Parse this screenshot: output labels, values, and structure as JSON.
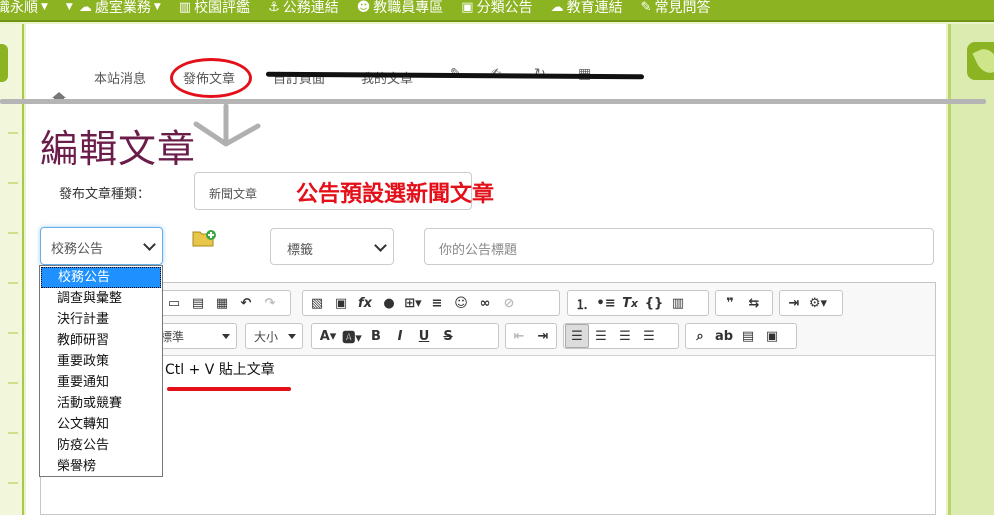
{
  "topnav": {
    "items": [
      {
        "icon": "dropdown-menu",
        "label": "識永順"
      },
      {
        "icon": "dropdown-menu",
        "label": "處室業務"
      },
      {
        "icon": "chart-icon",
        "label": "校園評鑑"
      },
      {
        "icon": "anchor-icon",
        "label": "公務連結"
      },
      {
        "icon": "smile-icon",
        "label": "教職員專區"
      },
      {
        "icon": "inbox-icon",
        "label": "分類公告"
      },
      {
        "icon": "cloud-icon",
        "label": "教育連結"
      },
      {
        "icon": "pen-icon",
        "label": "常見問答"
      }
    ]
  },
  "subnav": {
    "items": [
      "本站消息",
      "發佈文章",
      "自訂頁面",
      "我的文章"
    ]
  },
  "page_title": "編輯文章",
  "article_type": {
    "label": "發布文章種類：",
    "value": "新聞文章",
    "note": "公告預設選新聞文章"
  },
  "category_select": {
    "value": "校務公告",
    "options": [
      "校務公告",
      "調查與彙整",
      "決行計畫",
      "教師研習",
      "重要政策",
      "重要通知",
      "活動或競賽",
      "公文轉知",
      "防疫公告",
      "榮譽榜"
    ]
  },
  "tag_select": {
    "value": "標籤"
  },
  "title_input": {
    "placeholder": "你的公告標題"
  },
  "editor": {
    "style_combo": "標準",
    "size_combo": "大小",
    "content": "Ctl + V 貼上文章"
  },
  "colors": {
    "topbar": "#8cb321",
    "annotation_red": "#e3101a",
    "title": "#6b1d4a",
    "selected_option": "#1e90ff"
  }
}
